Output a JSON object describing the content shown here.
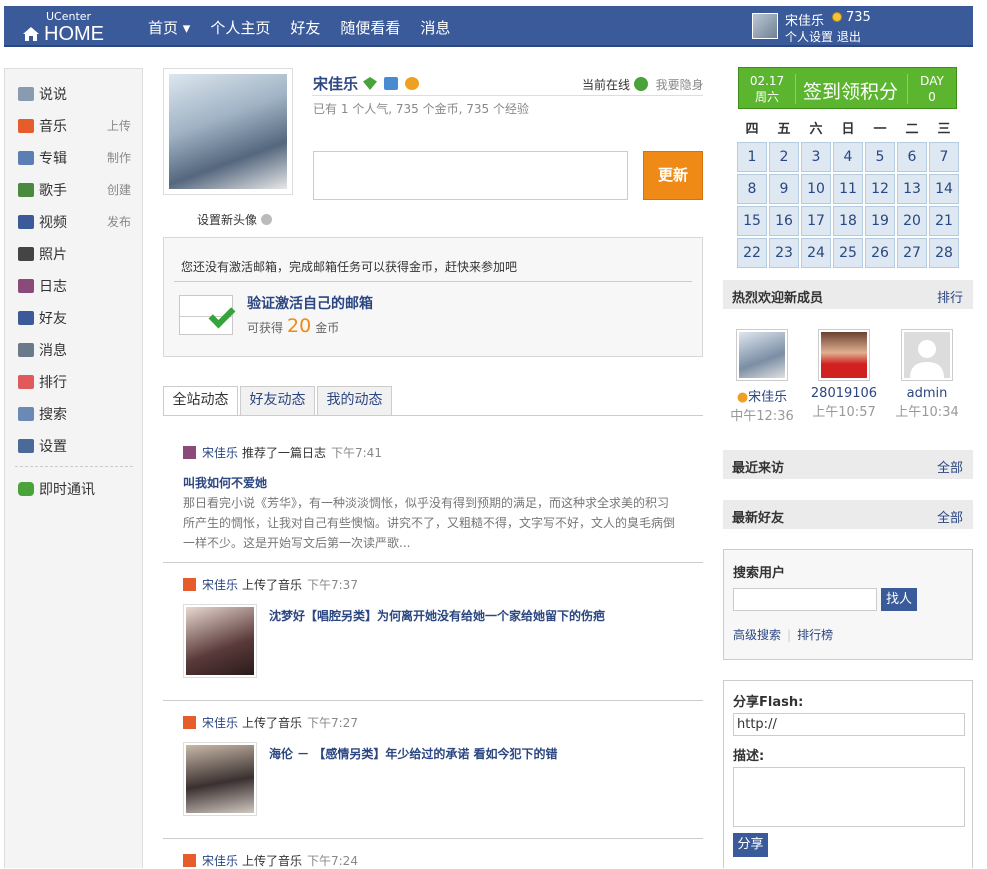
{
  "header": {
    "logo_small": "UCenter",
    "logo_big": "HOME",
    "nav": [
      "首页 ▾",
      "个人主页",
      "好友",
      "随便看看",
      "消息"
    ],
    "user_name": "宋佳乐",
    "coins": "735",
    "links": "个人设置 退出"
  },
  "sidebar": {
    "items": [
      {
        "label": "说说",
        "action": "",
        "icon": "speech-icon",
        "color": "#8a9bb0"
      },
      {
        "label": "音乐",
        "action": "上传",
        "icon": "music-icon",
        "color": "#e65c2a"
      },
      {
        "label": "专辑",
        "action": "制作",
        "icon": "album-icon",
        "color": "#5b7fb5"
      },
      {
        "label": "歌手",
        "action": "创建",
        "icon": "singer-icon",
        "color": "#4a8a3f"
      },
      {
        "label": "视频",
        "action": "发布",
        "icon": "video-icon",
        "color": "#3a5a9a"
      },
      {
        "label": "照片",
        "action": "",
        "icon": "camera-icon",
        "color": "#444444"
      },
      {
        "label": "日志",
        "action": "",
        "icon": "blog-icon",
        "color": "#8a4a7a"
      },
      {
        "label": "好友",
        "action": "",
        "icon": "friends-icon",
        "color": "#3a5a9a"
      },
      {
        "label": "消息",
        "action": "",
        "icon": "message-icon",
        "color": "#6a7a8a"
      },
      {
        "label": "排行",
        "action": "",
        "icon": "rank-icon",
        "color": "#e05a5a"
      },
      {
        "label": "搜索",
        "action": "",
        "icon": "search-icon",
        "color": "#6a8ab5"
      },
      {
        "label": "设置",
        "action": "",
        "icon": "settings-icon",
        "color": "#4a6a9a"
      }
    ],
    "im": "即时通讯"
  },
  "profile": {
    "set_avatar": "设置新头像",
    "name": "宋佳乐",
    "online": "当前在线",
    "hide": "我要隐身",
    "stats": "已有 1 个人气, 735 个金币, 735 个经验",
    "update": "更新"
  },
  "notice": {
    "text": "您还没有激活邮箱，完成邮箱任务可以获得金币，赶快来参加吧",
    "title": "验证激活自己的邮箱",
    "gain_prefix": "可获得",
    "gain_num": "20",
    "gain_suffix": "金币"
  },
  "tabs": [
    "全站动态",
    "好友动态",
    "我的动态"
  ],
  "feed": [
    {
      "who": "宋佳乐",
      "action": "推荐了一篇日志",
      "time": "下午7:41"
    },
    {
      "who": "宋佳乐",
      "action": "上传了音乐",
      "time": "下午7:37",
      "song": "沈梦好【唱腔另类】为何离开她没有给她一个家给她留下的伤疤"
    },
    {
      "who": "宋佳乐",
      "action": "上传了音乐",
      "time": "下午7:27",
      "song": "海伦 － 【感情另类】年少给过的承诺 看如今犯下的错"
    },
    {
      "who": "宋佳乐",
      "action": "上传了音乐",
      "time": "下午7:24"
    }
  ],
  "blog": {
    "title": "叫我如何不爱她",
    "body": "那日看完小说《芳华》，有一种淡淡惆怅，似乎没有得到预期的满足，而这种求全求美的积习所产生的惆怅，让我对自己有些懊恼。讲究不了，又粗糙不得，文字写不好，文人的臭毛病倒一样不少。这是开始写文后第一次读严歌..."
  },
  "signin": {
    "date": "02.17",
    "weekday": "周六",
    "main": "签到领积分",
    "day_label": "DAY",
    "day_num": "0"
  },
  "calendar": {
    "headers": [
      "四",
      "五",
      "六",
      "日",
      "一",
      "二",
      "三"
    ],
    "days": [
      "1",
      "2",
      "3",
      "4",
      "5",
      "6",
      "7",
      "8",
      "9",
      "10",
      "11",
      "12",
      "13",
      "14",
      "15",
      "16",
      "17",
      "18",
      "19",
      "20",
      "21",
      "22",
      "23",
      "24",
      "25",
      "26",
      "27",
      "28"
    ]
  },
  "hot": {
    "title": "热烈欢迎新成员",
    "link": "排行",
    "members": [
      {
        "name": "宋佳乐",
        "time": "中午12:36"
      },
      {
        "name": "28019106",
        "time": "上午10:57"
      },
      {
        "name": "admin",
        "time": "上午10:34"
      }
    ]
  },
  "visitors": {
    "title": "最近来访",
    "link": "全部"
  },
  "newfriends": {
    "title": "最新好友",
    "link": "全部"
  },
  "search": {
    "title": "搜索用户",
    "button": "找人",
    "adv": "高级搜索",
    "rank": "排行榜"
  },
  "flash": {
    "label": "分享Flash:",
    "url": "http://",
    "desc": "描述:",
    "button": "分享"
  }
}
